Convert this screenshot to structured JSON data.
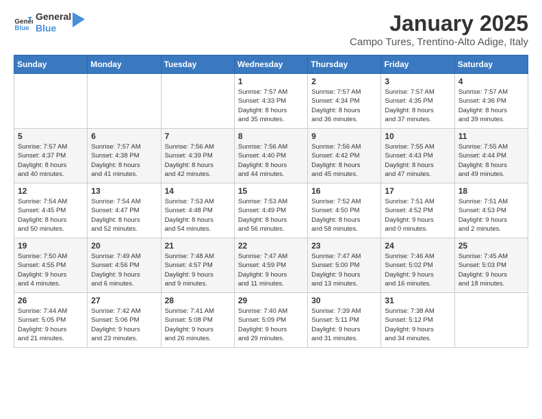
{
  "logo": {
    "text_general": "General",
    "text_blue": "Blue"
  },
  "title": "January 2025",
  "subtitle": "Campo Tures, Trentino-Alto Adige, Italy",
  "days_of_week": [
    "Sunday",
    "Monday",
    "Tuesday",
    "Wednesday",
    "Thursday",
    "Friday",
    "Saturday"
  ],
  "weeks": [
    [
      {
        "day": "",
        "info": ""
      },
      {
        "day": "",
        "info": ""
      },
      {
        "day": "",
        "info": ""
      },
      {
        "day": "1",
        "info": "Sunrise: 7:57 AM\nSunset: 4:33 PM\nDaylight: 8 hours\nand 35 minutes."
      },
      {
        "day": "2",
        "info": "Sunrise: 7:57 AM\nSunset: 4:34 PM\nDaylight: 8 hours\nand 36 minutes."
      },
      {
        "day": "3",
        "info": "Sunrise: 7:57 AM\nSunset: 4:35 PM\nDaylight: 8 hours\nand 37 minutes."
      },
      {
        "day": "4",
        "info": "Sunrise: 7:57 AM\nSunset: 4:36 PM\nDaylight: 8 hours\nand 39 minutes."
      }
    ],
    [
      {
        "day": "5",
        "info": "Sunrise: 7:57 AM\nSunset: 4:37 PM\nDaylight: 8 hours\nand 40 minutes."
      },
      {
        "day": "6",
        "info": "Sunrise: 7:57 AM\nSunset: 4:38 PM\nDaylight: 8 hours\nand 41 minutes."
      },
      {
        "day": "7",
        "info": "Sunrise: 7:56 AM\nSunset: 4:39 PM\nDaylight: 8 hours\nand 42 minutes."
      },
      {
        "day": "8",
        "info": "Sunrise: 7:56 AM\nSunset: 4:40 PM\nDaylight: 8 hours\nand 44 minutes."
      },
      {
        "day": "9",
        "info": "Sunrise: 7:56 AM\nSunset: 4:42 PM\nDaylight: 8 hours\nand 45 minutes."
      },
      {
        "day": "10",
        "info": "Sunrise: 7:55 AM\nSunset: 4:43 PM\nDaylight: 8 hours\nand 47 minutes."
      },
      {
        "day": "11",
        "info": "Sunrise: 7:55 AM\nSunset: 4:44 PM\nDaylight: 8 hours\nand 49 minutes."
      }
    ],
    [
      {
        "day": "12",
        "info": "Sunrise: 7:54 AM\nSunset: 4:45 PM\nDaylight: 8 hours\nand 50 minutes."
      },
      {
        "day": "13",
        "info": "Sunrise: 7:54 AM\nSunset: 4:47 PM\nDaylight: 8 hours\nand 52 minutes."
      },
      {
        "day": "14",
        "info": "Sunrise: 7:53 AM\nSunset: 4:48 PM\nDaylight: 8 hours\nand 54 minutes."
      },
      {
        "day": "15",
        "info": "Sunrise: 7:53 AM\nSunset: 4:49 PM\nDaylight: 8 hours\nand 56 minutes."
      },
      {
        "day": "16",
        "info": "Sunrise: 7:52 AM\nSunset: 4:50 PM\nDaylight: 8 hours\nand 58 minutes."
      },
      {
        "day": "17",
        "info": "Sunrise: 7:51 AM\nSunset: 4:52 PM\nDaylight: 9 hours\nand 0 minutes."
      },
      {
        "day": "18",
        "info": "Sunrise: 7:51 AM\nSunset: 4:53 PM\nDaylight: 9 hours\nand 2 minutes."
      }
    ],
    [
      {
        "day": "19",
        "info": "Sunrise: 7:50 AM\nSunset: 4:55 PM\nDaylight: 9 hours\nand 4 minutes."
      },
      {
        "day": "20",
        "info": "Sunrise: 7:49 AM\nSunset: 4:56 PM\nDaylight: 9 hours\nand 6 minutes."
      },
      {
        "day": "21",
        "info": "Sunrise: 7:48 AM\nSunset: 4:57 PM\nDaylight: 9 hours\nand 9 minutes."
      },
      {
        "day": "22",
        "info": "Sunrise: 7:47 AM\nSunset: 4:59 PM\nDaylight: 9 hours\nand 11 minutes."
      },
      {
        "day": "23",
        "info": "Sunrise: 7:47 AM\nSunset: 5:00 PM\nDaylight: 9 hours\nand 13 minutes."
      },
      {
        "day": "24",
        "info": "Sunrise: 7:46 AM\nSunset: 5:02 PM\nDaylight: 9 hours\nand 16 minutes."
      },
      {
        "day": "25",
        "info": "Sunrise: 7:45 AM\nSunset: 5:03 PM\nDaylight: 9 hours\nand 18 minutes."
      }
    ],
    [
      {
        "day": "26",
        "info": "Sunrise: 7:44 AM\nSunset: 5:05 PM\nDaylight: 9 hours\nand 21 minutes."
      },
      {
        "day": "27",
        "info": "Sunrise: 7:42 AM\nSunset: 5:06 PM\nDaylight: 9 hours\nand 23 minutes."
      },
      {
        "day": "28",
        "info": "Sunrise: 7:41 AM\nSunset: 5:08 PM\nDaylight: 9 hours\nand 26 minutes."
      },
      {
        "day": "29",
        "info": "Sunrise: 7:40 AM\nSunset: 5:09 PM\nDaylight: 9 hours\nand 29 minutes."
      },
      {
        "day": "30",
        "info": "Sunrise: 7:39 AM\nSunset: 5:11 PM\nDaylight: 9 hours\nand 31 minutes."
      },
      {
        "day": "31",
        "info": "Sunrise: 7:38 AM\nSunset: 5:12 PM\nDaylight: 9 hours\nand 34 minutes."
      },
      {
        "day": "",
        "info": ""
      }
    ]
  ]
}
